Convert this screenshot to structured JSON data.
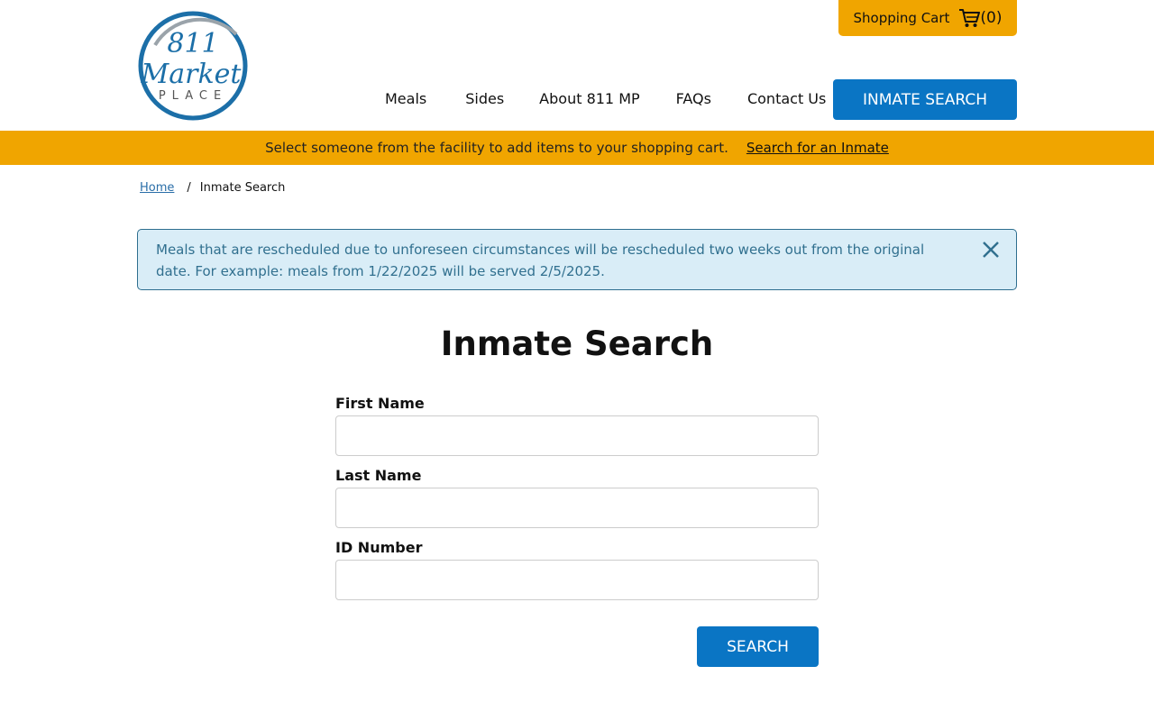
{
  "logo": {
    "line1": "811",
    "line2": "Market",
    "line3": "PLACE"
  },
  "header": {
    "cart_label": "Shopping Cart",
    "cart_count": "(0)",
    "nav": [
      "Meals",
      "Sides",
      "About 811 MP",
      "FAQs",
      "Contact Us"
    ],
    "inmate_search_button": "INMATE SEARCH"
  },
  "banner": {
    "text": "Select someone from the facility to add items to your shopping cart.",
    "link": "Search for an Inmate"
  },
  "breadcrumb": {
    "home": "Home",
    "separator": "/",
    "current": "Inmate Search"
  },
  "alert": {
    "message": "Meals that are rescheduled due to unforeseen circumstances will be rescheduled two weeks out from the original date. For example: meals from 1/22/2025 will be served 2/5/2025."
  },
  "page": {
    "title": "Inmate Search"
  },
  "form": {
    "first_name_label": "First Name",
    "first_name_value": "",
    "last_name_label": "Last Name",
    "last_name_value": "",
    "id_label": "ID Number",
    "id_value": "",
    "search_button": "SEARCH"
  },
  "colors": {
    "accent_orange": "#f0a500",
    "primary_blue": "#0a75c4",
    "alert_bg": "#d9edf7",
    "alert_text": "#31708f"
  }
}
